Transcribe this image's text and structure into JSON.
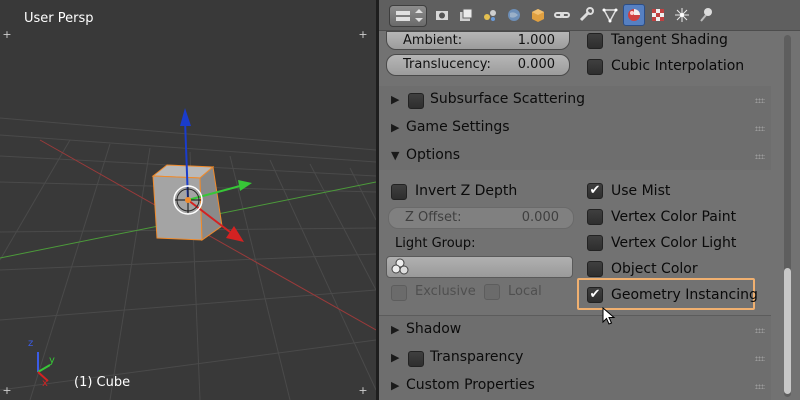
{
  "viewport": {
    "view_label": "User Persp",
    "object_label": "(1) Cube",
    "axis_labels": {
      "x": "x",
      "y": "y",
      "z": "z"
    }
  },
  "properties": {
    "tabs": [
      "render-icon",
      "render-layers-icon",
      "scene-icon",
      "world-icon",
      "object-icon",
      "constraints-icon",
      "modifiers-icon",
      "data-icon",
      "material-icon",
      "texture-icon",
      "particles-icon",
      "physics-icon"
    ],
    "shading": {
      "ambient_label": "Ambient:",
      "ambient_value": "1.000",
      "translucency_label": "Translucency:",
      "translucency_value": "0.000",
      "tangent_shading": "Tangent Shading",
      "cubic_interpolation": "Cubic Interpolation"
    },
    "panels": {
      "subsurface": "Subsurface Scattering",
      "game_settings": "Game Settings",
      "options": "Options",
      "shadow": "Shadow",
      "transparency": "Transparency",
      "custom_properties": "Custom Properties"
    },
    "options": {
      "invert_z_depth": "Invert Z Depth",
      "z_offset_label": "Z Offset:",
      "z_offset_value": "0.000",
      "light_group_label": "Light Group:",
      "exclusive": "Exclusive",
      "local": "Local",
      "use_mist": "Use Mist",
      "vertex_color_paint": "Vertex Color Paint",
      "vertex_color_light": "Vertex Color Light",
      "object_color": "Object Color",
      "geometry_instancing": "Geometry Instancing"
    },
    "checks": "✔",
    "colors": {
      "accent_highlight": "#f0b070",
      "active_tab": "#5680c2"
    }
  }
}
